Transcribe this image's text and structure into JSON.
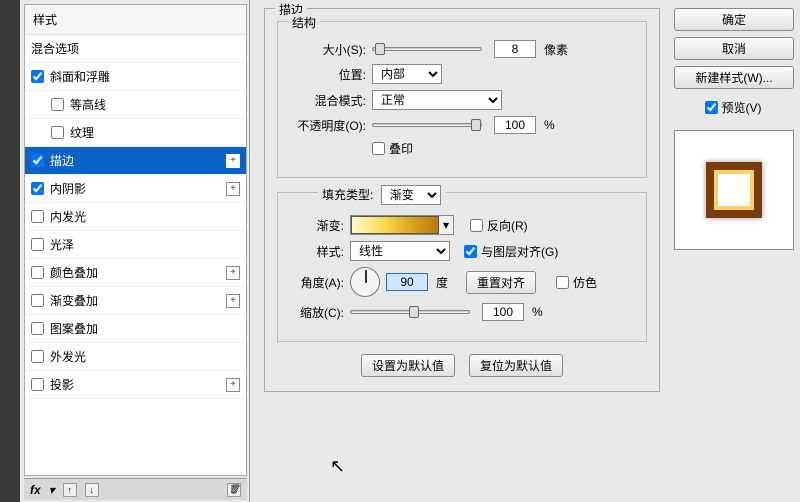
{
  "dialog": {
    "stroke_title": "描边"
  },
  "styles_header": "样式",
  "styles": [
    {
      "label": "混合选项",
      "checked": null,
      "indent": false,
      "fx": false
    },
    {
      "label": "斜面和浮雕",
      "checked": true,
      "indent": false,
      "fx": false
    },
    {
      "label": "等高线",
      "checked": false,
      "indent": true,
      "fx": false
    },
    {
      "label": "纹理",
      "checked": false,
      "indent": true,
      "fx": false
    },
    {
      "label": "描边",
      "checked": true,
      "indent": false,
      "fx": true,
      "selected": true
    },
    {
      "label": "内阴影",
      "checked": true,
      "indent": false,
      "fx": true
    },
    {
      "label": "内发光",
      "checked": false,
      "indent": false,
      "fx": false
    },
    {
      "label": "光泽",
      "checked": false,
      "indent": false,
      "fx": false
    },
    {
      "label": "颜色叠加",
      "checked": false,
      "indent": false,
      "fx": true
    },
    {
      "label": "渐变叠加",
      "checked": false,
      "indent": false,
      "fx": true
    },
    {
      "label": "图案叠加",
      "checked": false,
      "indent": false,
      "fx": false
    },
    {
      "label": "外发光",
      "checked": false,
      "indent": false,
      "fx": false
    },
    {
      "label": "投影",
      "checked": false,
      "indent": false,
      "fx": true
    }
  ],
  "bottom_bar": {
    "fx": "fx"
  },
  "structure": {
    "title": "结构",
    "size_label": "大小(S):",
    "size_value": "8",
    "size_unit": "像素",
    "position_label": "位置:",
    "position_value": "内部",
    "blend_label": "混合模式:",
    "blend_value": "正常",
    "opacity_label": "不透明度(O):",
    "opacity_value": "100",
    "opacity_unit": "%",
    "overprint_label": "叠印"
  },
  "fill": {
    "type_label": "填充类型:",
    "type_value": "渐变",
    "gradient_label": "渐变:",
    "reverse_label": "反向(R)",
    "style_label": "样式:",
    "style_value": "线性",
    "align_label": "与图层对齐(G)",
    "angle_label": "角度(A):",
    "angle_value": "90",
    "angle_unit": "度",
    "reset_align": "重置对齐",
    "dither_label": "仿色",
    "scale_label": "缩放(C):",
    "scale_value": "100",
    "scale_unit": "%"
  },
  "action_buttons": {
    "make_default": "设置为默认值",
    "reset_default": "复位为默认值"
  },
  "right": {
    "ok": "确定",
    "cancel": "取消",
    "new_style": "新建样式(W)...",
    "preview": "预览(V)"
  }
}
